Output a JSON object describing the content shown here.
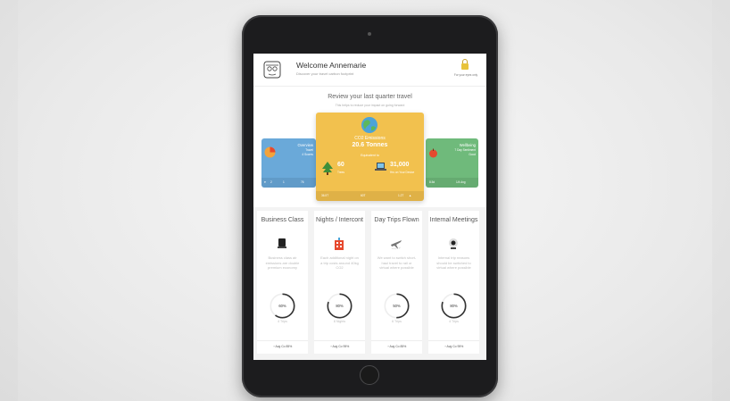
{
  "header": {
    "welcome": "Welcome Annemarie",
    "subtitle": "Discover your travel carbon footprint",
    "lock_label": "For your eyes only"
  },
  "review": {
    "title": "Review your last quarter travel",
    "subtitle": "This helps to reduce your impact on going forward"
  },
  "cards": {
    "overview": {
      "title": "Overview",
      "line1": "Travel",
      "line2": "4 Scores",
      "foot_a": "2",
      "foot_b": "1",
      "foot_c": "76"
    },
    "co2": {
      "title": "CO2 Emissions",
      "value": "20.6 Tonnes",
      "equivalent": "Equivalent to",
      "trees_value": "60",
      "trees_label": "Trees",
      "hours_value": "31,000",
      "hours_label": "Hrs on Your Device",
      "foot_a": "36.5T",
      "foot_b": "60T",
      "foot_c": "1.2T"
    },
    "wellbeing": {
      "title": "Wellbeing",
      "line1": "7 Day Sentiment",
      "line2": "Good",
      "foot_a": "8.5d",
      "foot_b": "1/4 Avg"
    }
  },
  "columns": [
    {
      "title": "Business Class",
      "icon": "seat-icon",
      "desc": "Business class air emissions are double premium economy",
      "percent": "60%",
      "percent_value": 60,
      "count": "4 Trips",
      "foot": "Avg Co 85%"
    },
    {
      "title": "Nights / Intercont",
      "icon": "hotel-icon",
      "desc": "Each additional night on a trip costs around 40kg CO2",
      "percent": "80%",
      "percent_value": 80,
      "count": "8 Nights",
      "foot": "Avg Co 95%"
    },
    {
      "title": "Day Trips Flown",
      "icon": "plane-icon",
      "desc": "We want to switch short-haul travel to rail or virtual where possible",
      "percent": "50%",
      "percent_value": 50,
      "count": "6 Trips",
      "foot": "Avg Co 85%"
    },
    {
      "title": "Internal Meetings",
      "icon": "webcam-icon",
      "desc": "Internal trip reasons should be switched to virtual where possible",
      "percent": "80%",
      "percent_value": 80,
      "count": "4 Trips",
      "foot": "Avg Co 95%"
    }
  ],
  "colors": {
    "overview": "#6aa9d9",
    "co2": "#f2c14e",
    "wellbeing": "#6fba7b",
    "ring": "#333333"
  }
}
